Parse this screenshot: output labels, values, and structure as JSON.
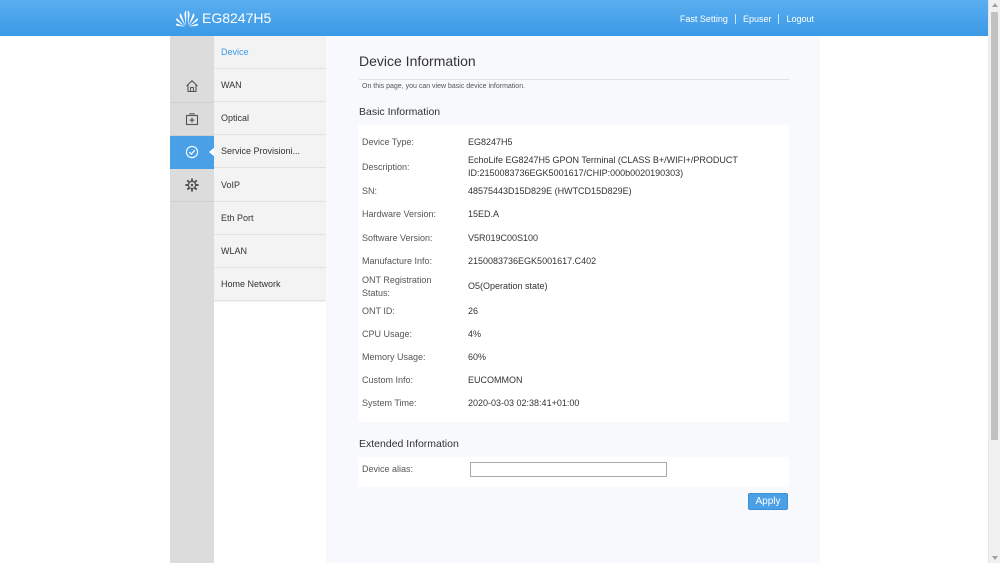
{
  "header": {
    "product_name": "EG8247H5",
    "links": [
      {
        "label": "Fast Setting"
      },
      {
        "label": "Epuser"
      },
      {
        "label": "Logout"
      }
    ],
    "colors": {
      "bar": "#3b99e6",
      "accent": "#4aa0e6"
    }
  },
  "icon_nav": [
    {
      "name": "home-icon",
      "active": false
    },
    {
      "name": "first-aid-kit-icon",
      "active": false
    },
    {
      "name": "check-circle-icon",
      "active": true
    },
    {
      "name": "gear-icon",
      "active": false
    }
  ],
  "menu": {
    "items": [
      {
        "label": "Device",
        "active": true
      },
      {
        "label": "WAN",
        "active": false
      },
      {
        "label": "Optical",
        "active": false
      },
      {
        "label": "Service Provisioni...",
        "active": false
      },
      {
        "label": "VoIP",
        "active": false
      },
      {
        "label": "Eth Port",
        "active": false
      },
      {
        "label": "WLAN",
        "active": false
      },
      {
        "label": "Home Network",
        "active": false
      }
    ]
  },
  "page": {
    "title": "Device Information",
    "description": "On this page, you can view basic device information."
  },
  "basic_info": {
    "title": "Basic Information",
    "rows": [
      {
        "label": "Device Type:",
        "value": "EG8247H5"
      },
      {
        "label": "Description:",
        "value_line1": "EchoLife EG8247H5 GPON Terminal (CLASS B+/WIFI+/PRODUCT",
        "value_line2": "ID:2150083736EGK5001617/CHIP:000b0020190303)"
      },
      {
        "label": "SN:",
        "value": "48575443D15D829E (HWTCD15D829E)"
      },
      {
        "label": "Hardware Version:",
        "value": "15ED.A"
      },
      {
        "label": "Software Version:",
        "value": "V5R019C00S100"
      },
      {
        "label": "Manufacture Info:",
        "value": "2150083736EGK5001617.C402"
      },
      {
        "label_line1": "ONT Registration",
        "label_line2": "Status:",
        "value": "O5(Operation state)"
      },
      {
        "label": "ONT ID:",
        "value": "26"
      },
      {
        "label": "CPU Usage:",
        "value": "4%"
      },
      {
        "label": "Memory Usage:",
        "value": "60%"
      },
      {
        "label": "Custom Info:",
        "value": "EUCOMMON"
      },
      {
        "label": "System Time:",
        "value": "2020-03-03 02:38:41+01:00"
      }
    ]
  },
  "extended_info": {
    "title": "Extended Information",
    "alias_label": "Device alias:",
    "alias_value": "",
    "apply_label": "Apply"
  }
}
